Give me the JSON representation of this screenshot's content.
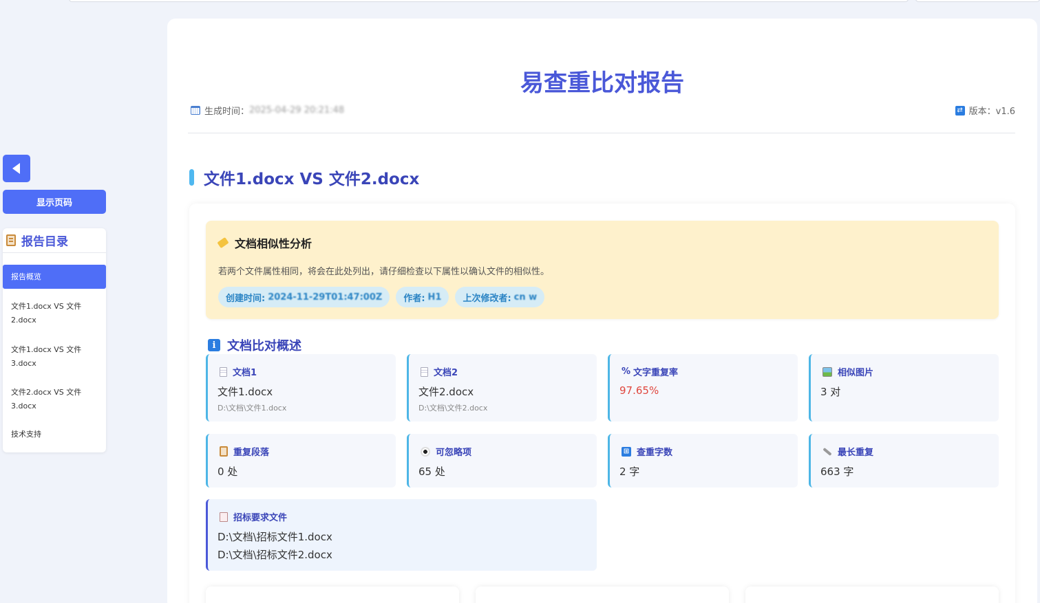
{
  "sidebar": {
    "show_page_label": "显示页码",
    "toc_title": "报告目录",
    "items": [
      {
        "label": "报告概览"
      },
      {
        "label": "文件1.docx VS 文件2.docx"
      },
      {
        "label": "文件1.docx VS 文件3.docx"
      },
      {
        "label": "文件2.docx VS 文件3.docx"
      },
      {
        "label": "技术支持"
      }
    ]
  },
  "report": {
    "title": "易查重比对报告",
    "generated_label": "生成时间：",
    "generated_value": "2025-04-29 20:21:48",
    "version_label": "版本：v1.6"
  },
  "comparison": {
    "title": "文件1.docx VS 文件2.docx",
    "similarity": {
      "title": "文档相似性分析",
      "description": "若两个文件属性相同，将会在此处列出，请仔细检查以下属性以确认文件的相似性。",
      "pills": [
        {
          "label": "创建时间:",
          "value": "2024-11-29T01:47:00Z"
        },
        {
          "label": "作者:",
          "value": "H1"
        },
        {
          "label": "上次修改者:",
          "value": "cn w"
        }
      ]
    },
    "overview_title": "文档比对概述",
    "stats": [
      {
        "label": "文档1",
        "value": "文件1.docx",
        "sub": "D:\\文档\\文件1.docx"
      },
      {
        "label": "文档2",
        "value": "文件2.docx",
        "sub": "D:\\文档\\文件2.docx"
      },
      {
        "label": "文字重复率",
        "value": "97.65%"
      },
      {
        "label": "相似图片",
        "value": "3 对"
      },
      {
        "label": "重复段落",
        "value": "0 处"
      },
      {
        "label": "可忽略项",
        "value": "65 处"
      },
      {
        "label": "查重字数",
        "value": "2 字"
      },
      {
        "label": "最长重复",
        "value": "663 字"
      }
    ],
    "requirement": {
      "label": "招标要求文件",
      "files": [
        "D:\\文档\\招标文件1.docx",
        "D:\\文档\\招标文件2.docx"
      ]
    }
  },
  "colors": {
    "accent": "#4f6ef7",
    "title": "#4a58d8",
    "highlight_red": "#e0473e"
  }
}
